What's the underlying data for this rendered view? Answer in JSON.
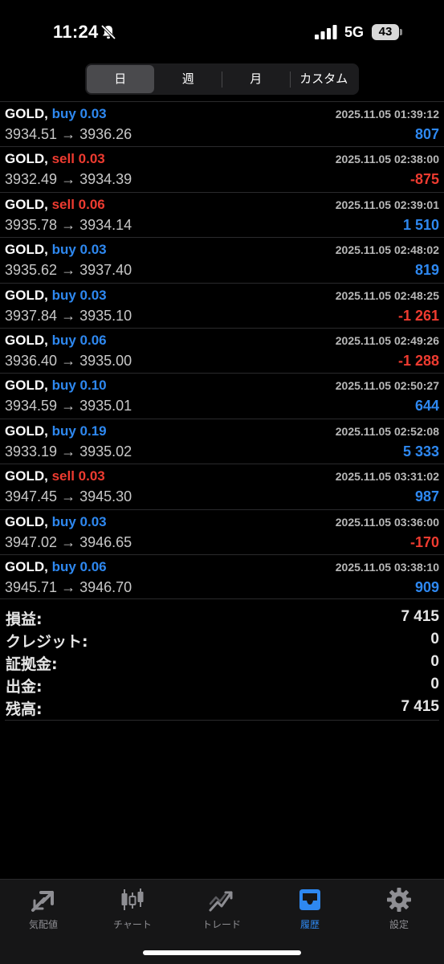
{
  "status_bar": {
    "time": "11:24",
    "network": "5G",
    "battery": "43"
  },
  "period_tabs": [
    {
      "label": "日",
      "active": true
    },
    {
      "label": "週",
      "active": false
    },
    {
      "label": "月",
      "active": false
    },
    {
      "label": "カスタム",
      "active": false
    }
  ],
  "trades": [
    {
      "symbol": "GOLD,",
      "side": "buy",
      "volume": "0.03",
      "datetime": "2025.11.05 01:39:12",
      "open": "3934.51",
      "close": "3936.26",
      "profit": "807"
    },
    {
      "symbol": "GOLD,",
      "side": "sell",
      "volume": "0.03",
      "datetime": "2025.11.05 02:38:00",
      "open": "3932.49",
      "close": "3934.39",
      "profit": "-875"
    },
    {
      "symbol": "GOLD,",
      "side": "sell",
      "volume": "0.06",
      "datetime": "2025.11.05 02:39:01",
      "open": "3935.78",
      "close": "3934.14",
      "profit": "1 510"
    },
    {
      "symbol": "GOLD,",
      "side": "buy",
      "volume": "0.03",
      "datetime": "2025.11.05 02:48:02",
      "open": "3935.62",
      "close": "3937.40",
      "profit": "819"
    },
    {
      "symbol": "GOLD,",
      "side": "buy",
      "volume": "0.03",
      "datetime": "2025.11.05 02:48:25",
      "open": "3937.84",
      "close": "3935.10",
      "profit": "-1 261"
    },
    {
      "symbol": "GOLD,",
      "side": "buy",
      "volume": "0.06",
      "datetime": "2025.11.05 02:49:26",
      "open": "3936.40",
      "close": "3935.00",
      "profit": "-1 288"
    },
    {
      "symbol": "GOLD,",
      "side": "buy",
      "volume": "0.10",
      "datetime": "2025.11.05 02:50:27",
      "open": "3934.59",
      "close": "3935.01",
      "profit": "644"
    },
    {
      "symbol": "GOLD,",
      "side": "buy",
      "volume": "0.19",
      "datetime": "2025.11.05 02:52:08",
      "open": "3933.19",
      "close": "3935.02",
      "profit": "5 333"
    },
    {
      "symbol": "GOLD,",
      "side": "sell",
      "volume": "0.03",
      "datetime": "2025.11.05 03:31:02",
      "open": "3947.45",
      "close": "3945.30",
      "profit": "987"
    },
    {
      "symbol": "GOLD,",
      "side": "buy",
      "volume": "0.03",
      "datetime": "2025.11.05 03:36:00",
      "open": "3947.02",
      "close": "3946.65",
      "profit": "-170"
    },
    {
      "symbol": "GOLD,",
      "side": "buy",
      "volume": "0.06",
      "datetime": "2025.11.05 03:38:10",
      "open": "3945.71",
      "close": "3946.70",
      "profit": "909"
    }
  ],
  "arrow": "→",
  "summary": [
    {
      "label": "損益:",
      "value": "7 415"
    },
    {
      "label": "クレジット:",
      "value": "0"
    },
    {
      "label": "証拠金:",
      "value": "0"
    },
    {
      "label": "出金:",
      "value": "0"
    },
    {
      "label": "残高:",
      "value": "7 415"
    }
  ],
  "tab_bar": [
    {
      "label": "気配値",
      "icon": "quotes-arrows-icon",
      "active": false
    },
    {
      "label": "チャート",
      "icon": "candlestick-chart-icon",
      "active": false
    },
    {
      "label": "トレード",
      "icon": "trade-trend-icon",
      "active": false
    },
    {
      "label": "履歴",
      "icon": "inbox-tray-icon",
      "active": true
    },
    {
      "label": "設定",
      "icon": "gear-icon",
      "active": false
    }
  ],
  "colors": {
    "buy": "#2e88f0",
    "sell": "#ee3b30",
    "positive": "#2e88f0",
    "negative": "#ee3b30",
    "active_tab": "#2e88f0",
    "inactive_tab": "#8e8e93"
  }
}
